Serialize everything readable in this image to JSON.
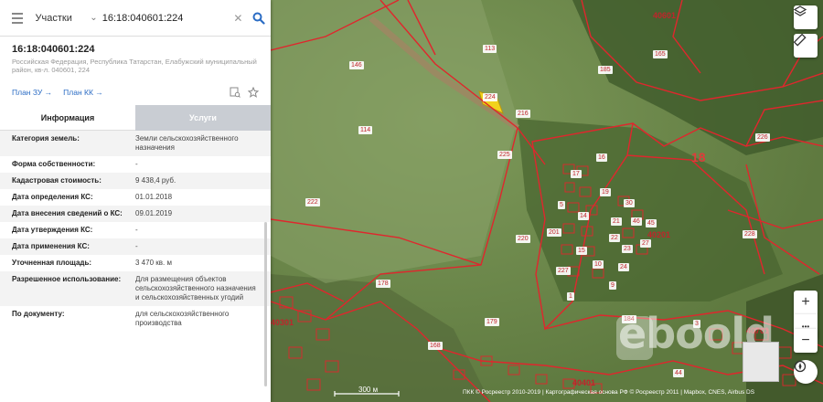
{
  "search": {
    "type": "Участки",
    "query": "16:18:040601:224"
  },
  "object": {
    "cad_number": "16:18:040601:224",
    "address": "Российская Федерация, Республика Татарстан, Елабужский муниципальный район, кв-л. 040601, 224"
  },
  "links": {
    "plan_zu": "План ЗУ →",
    "plan_kk": "План КК →"
  },
  "tabs": [
    {
      "label": "Информация"
    },
    {
      "label": "Услуги"
    }
  ],
  "info_rows": [
    {
      "key": "Категория земель:",
      "value": "Земли сельскохозяйственного назначения"
    },
    {
      "key": "Форма собственности:",
      "value": "-"
    },
    {
      "key": "Кадастровая стоимость:",
      "value": "9 438,4 руб."
    },
    {
      "key": "Дата определения КС:",
      "value": "01.01.2018"
    },
    {
      "key": "Дата внесения сведений о КС:",
      "value": "09.01.2019"
    },
    {
      "key": "Дата утверждения КС:",
      "value": "-"
    },
    {
      "key": "Дата применения КС:",
      "value": "-"
    },
    {
      "key": "Уточненная площадь:",
      "value": "3 470 кв. м"
    },
    {
      "key": "Разрешенное использование:",
      "value": "Для размещения объектов сельскохозяйственного назначения и сельскохозяйственных угодий"
    },
    {
      "key": "По документу:",
      "value": "для сельскохозяйственного производства"
    }
  ],
  "map": {
    "plot_labels": [
      {
        "text": "146"
      },
      {
        "text": "113"
      },
      {
        "text": "185"
      },
      {
        "text": "165"
      },
      {
        "text": "114"
      },
      {
        "text": "224"
      },
      {
        "text": "216"
      },
      {
        "text": "226"
      },
      {
        "text": "222"
      },
      {
        "text": "225"
      },
      {
        "text": "220"
      },
      {
        "text": "178"
      },
      {
        "text": "201"
      },
      {
        "text": "227"
      },
      {
        "text": "228"
      },
      {
        "text": "179"
      },
      {
        "text": "168"
      },
      {
        "text": "184"
      },
      {
        "text": "3"
      },
      {
        "text": "44"
      },
      {
        "text": "1"
      },
      {
        "text": "10"
      },
      {
        "text": "9"
      },
      {
        "text": "24"
      },
      {
        "text": "23"
      },
      {
        "text": "16"
      },
      {
        "text": "17"
      },
      {
        "text": "19"
      },
      {
        "text": "5"
      },
      {
        "text": "21"
      },
      {
        "text": "46"
      },
      {
        "text": "45"
      },
      {
        "text": "30"
      },
      {
        "text": "22"
      },
      {
        "text": "27"
      },
      {
        "text": "14"
      },
      {
        "text": "15"
      }
    ],
    "quarters": [
      {
        "text": "40601"
      },
      {
        "text": "40201"
      },
      {
        "text": "40701"
      },
      {
        "text": "40401"
      },
      {
        "text": "40301"
      }
    ],
    "big_labels": [
      {
        "text": "18"
      }
    ],
    "scale": "300 м",
    "copyright": "ПКК © Росреестр 2010-2019 | Картографическая основа РФ © Росреестр 2011 | Mapbox, CNES, Airbus DS",
    "watermark": "eboold",
    "controls": {
      "zoom_in": "+",
      "zoom_out": "−",
      "more": "•••"
    }
  },
  "colors": {
    "boundary": "#e0262d",
    "link": "#2b6cc4",
    "highlight": "#f2d21c"
  },
  "icons": [
    "menu-icon",
    "chevron-down-icon",
    "clear-icon",
    "search-icon",
    "print-icon",
    "star-icon",
    "layers-icon",
    "ruler-icon",
    "compass-icon"
  ]
}
